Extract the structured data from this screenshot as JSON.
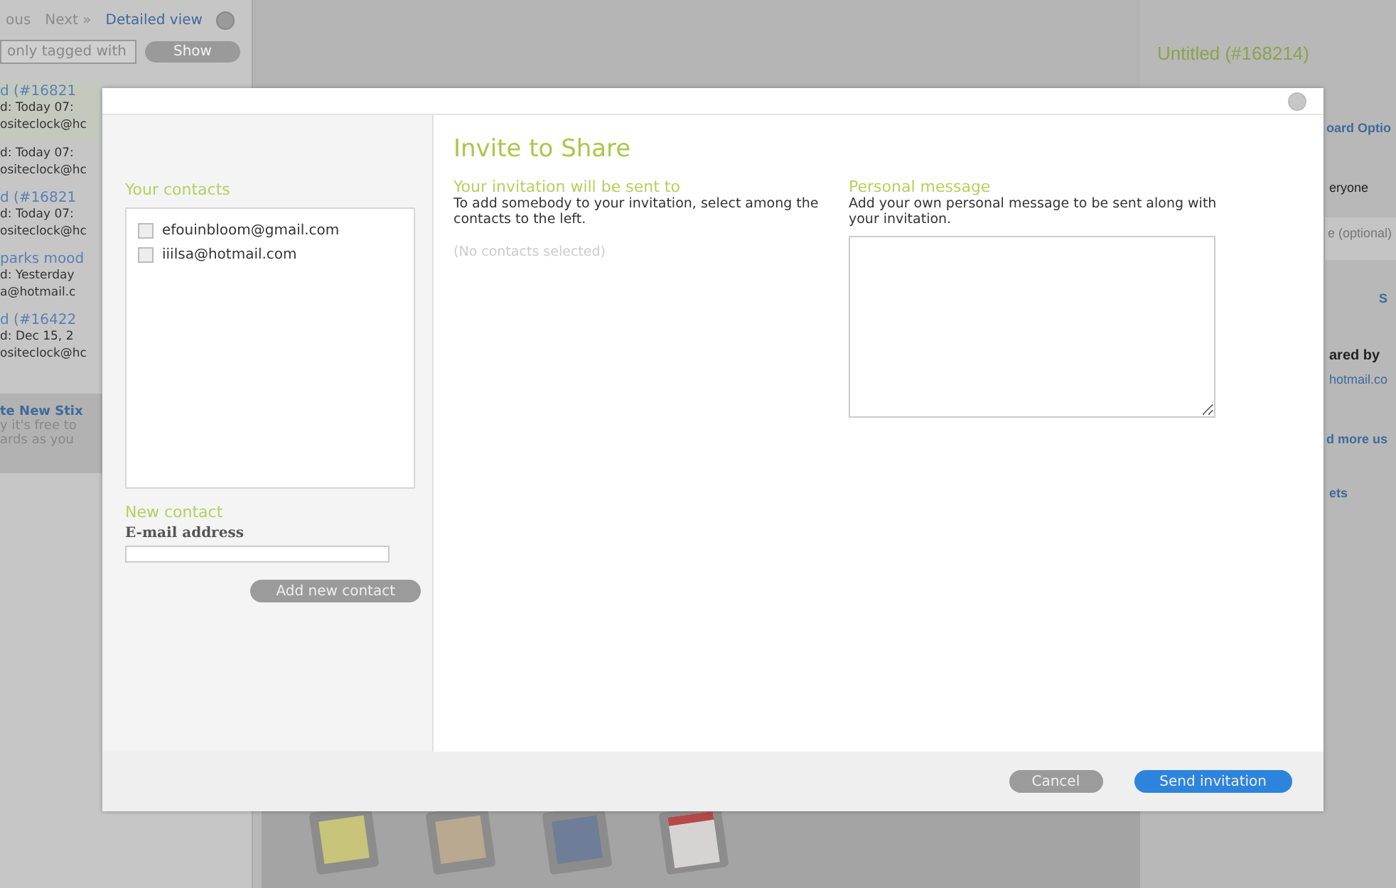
{
  "background": {
    "nav": {
      "previous": "ous",
      "next": "Next »",
      "detailed_view": "Detailed view"
    },
    "filter": {
      "value": "only tagged with",
      "button": "Show"
    },
    "items": [
      {
        "title": "d (#16821",
        "date": "d: Today 07:",
        "owner": "ositeclock@hc"
      },
      {
        "date": "d: Today 07:",
        "owner": "ositeclock@hc"
      },
      {
        "title": "d (#16821",
        "date": "d: Today 07:",
        "owner": "ositeclock@hc"
      },
      {
        "title": "parks mood",
        "date": "d: Yesterday",
        "owner": "a@hotmail.c"
      },
      {
        "title": "d (#16422",
        "date": "d: Dec 15, 2",
        "owner": "ositeclock@hc"
      }
    ],
    "promo": {
      "title": "te New Stix",
      "lines": [
        "y it's free to",
        "ards as you"
      ]
    },
    "side": {
      "title": "Untitled (#168214)",
      "options": "oard Optio",
      "audience": "eryone",
      "note_placeholder": "e (optional)",
      "save": "S",
      "shared_by": "ared by",
      "shared_email": "hotmail.co",
      "add_more": "d more us",
      "widgets": "ets"
    }
  },
  "dialog": {
    "title": "Invite to Share",
    "contacts": {
      "heading": "Your contacts",
      "items": [
        {
          "email": "efouinbloom@gmail.com",
          "checked": false
        },
        {
          "email": "iiilsa@hotmail.com",
          "checked": false
        }
      ]
    },
    "new_contact": {
      "heading": "New contact",
      "label": "E-mail address",
      "button": "Add new contact"
    },
    "recipients": {
      "heading": "Your invitation will be sent to",
      "hint": "To add somebody to your invitation, select among the contacts to the left.",
      "empty_note": "(No contacts selected)"
    },
    "message": {
      "heading": "Personal message",
      "hint": "Add your own personal message to be sent along with your invitation."
    },
    "buttons": [
      {
        "label": "Cancel",
        "kind": "secondary"
      },
      {
        "label": "Send invitation",
        "kind": "primary"
      }
    ]
  }
}
